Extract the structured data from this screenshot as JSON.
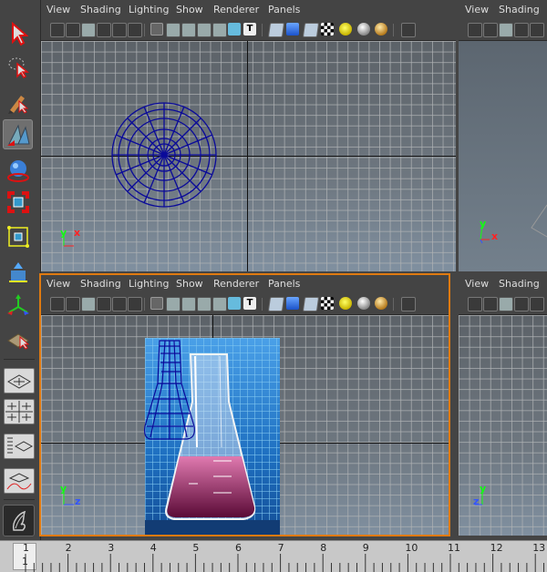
{
  "viewports": {
    "top_left": {
      "menu": [
        "View",
        "Shading",
        "Lighting",
        "Show",
        "Renderer",
        "Panels"
      ],
      "axis_y": "y",
      "axis_x": "x"
    },
    "top_right": {
      "menu": [
        "View",
        "Shading"
      ],
      "axis_y": "y",
      "axis_x": "x"
    },
    "bottom_left": {
      "menu": [
        "View",
        "Shading",
        "Lighting",
        "Show",
        "Renderer",
        "Panels"
      ],
      "axis_y": "y",
      "axis_x": "z"
    },
    "bottom_right": {
      "menu": [
        "View",
        "Shading"
      ],
      "axis_y": "y",
      "axis_x": "z"
    }
  },
  "toolbar_icons": [
    "select-arrow-icon",
    "lasso-select-icon",
    "paint-select-icon",
    "move-tool-icon",
    "rotate-tool-icon",
    "scale-tool-icon",
    "universal-manipulator-icon",
    "soft-mod-icon",
    "show-manipulator-icon",
    "last-tool-icon",
    "single-perspective-layout-icon",
    "four-view-layout-icon",
    "outliner-layout-icon",
    "graph-editor-layout-icon",
    "hypershade-icon"
  ],
  "timeline": {
    "ticks": [
      "1",
      "2",
      "3",
      "4",
      "5",
      "6",
      "7",
      "8",
      "9",
      "10",
      "11",
      "12",
      "13"
    ],
    "current_frame": "1"
  },
  "colors": {
    "active_border": "#e07a10",
    "wireframe": "#0a0a9a",
    "axis_y": "#22ff22",
    "axis_x": "#ff2222"
  }
}
